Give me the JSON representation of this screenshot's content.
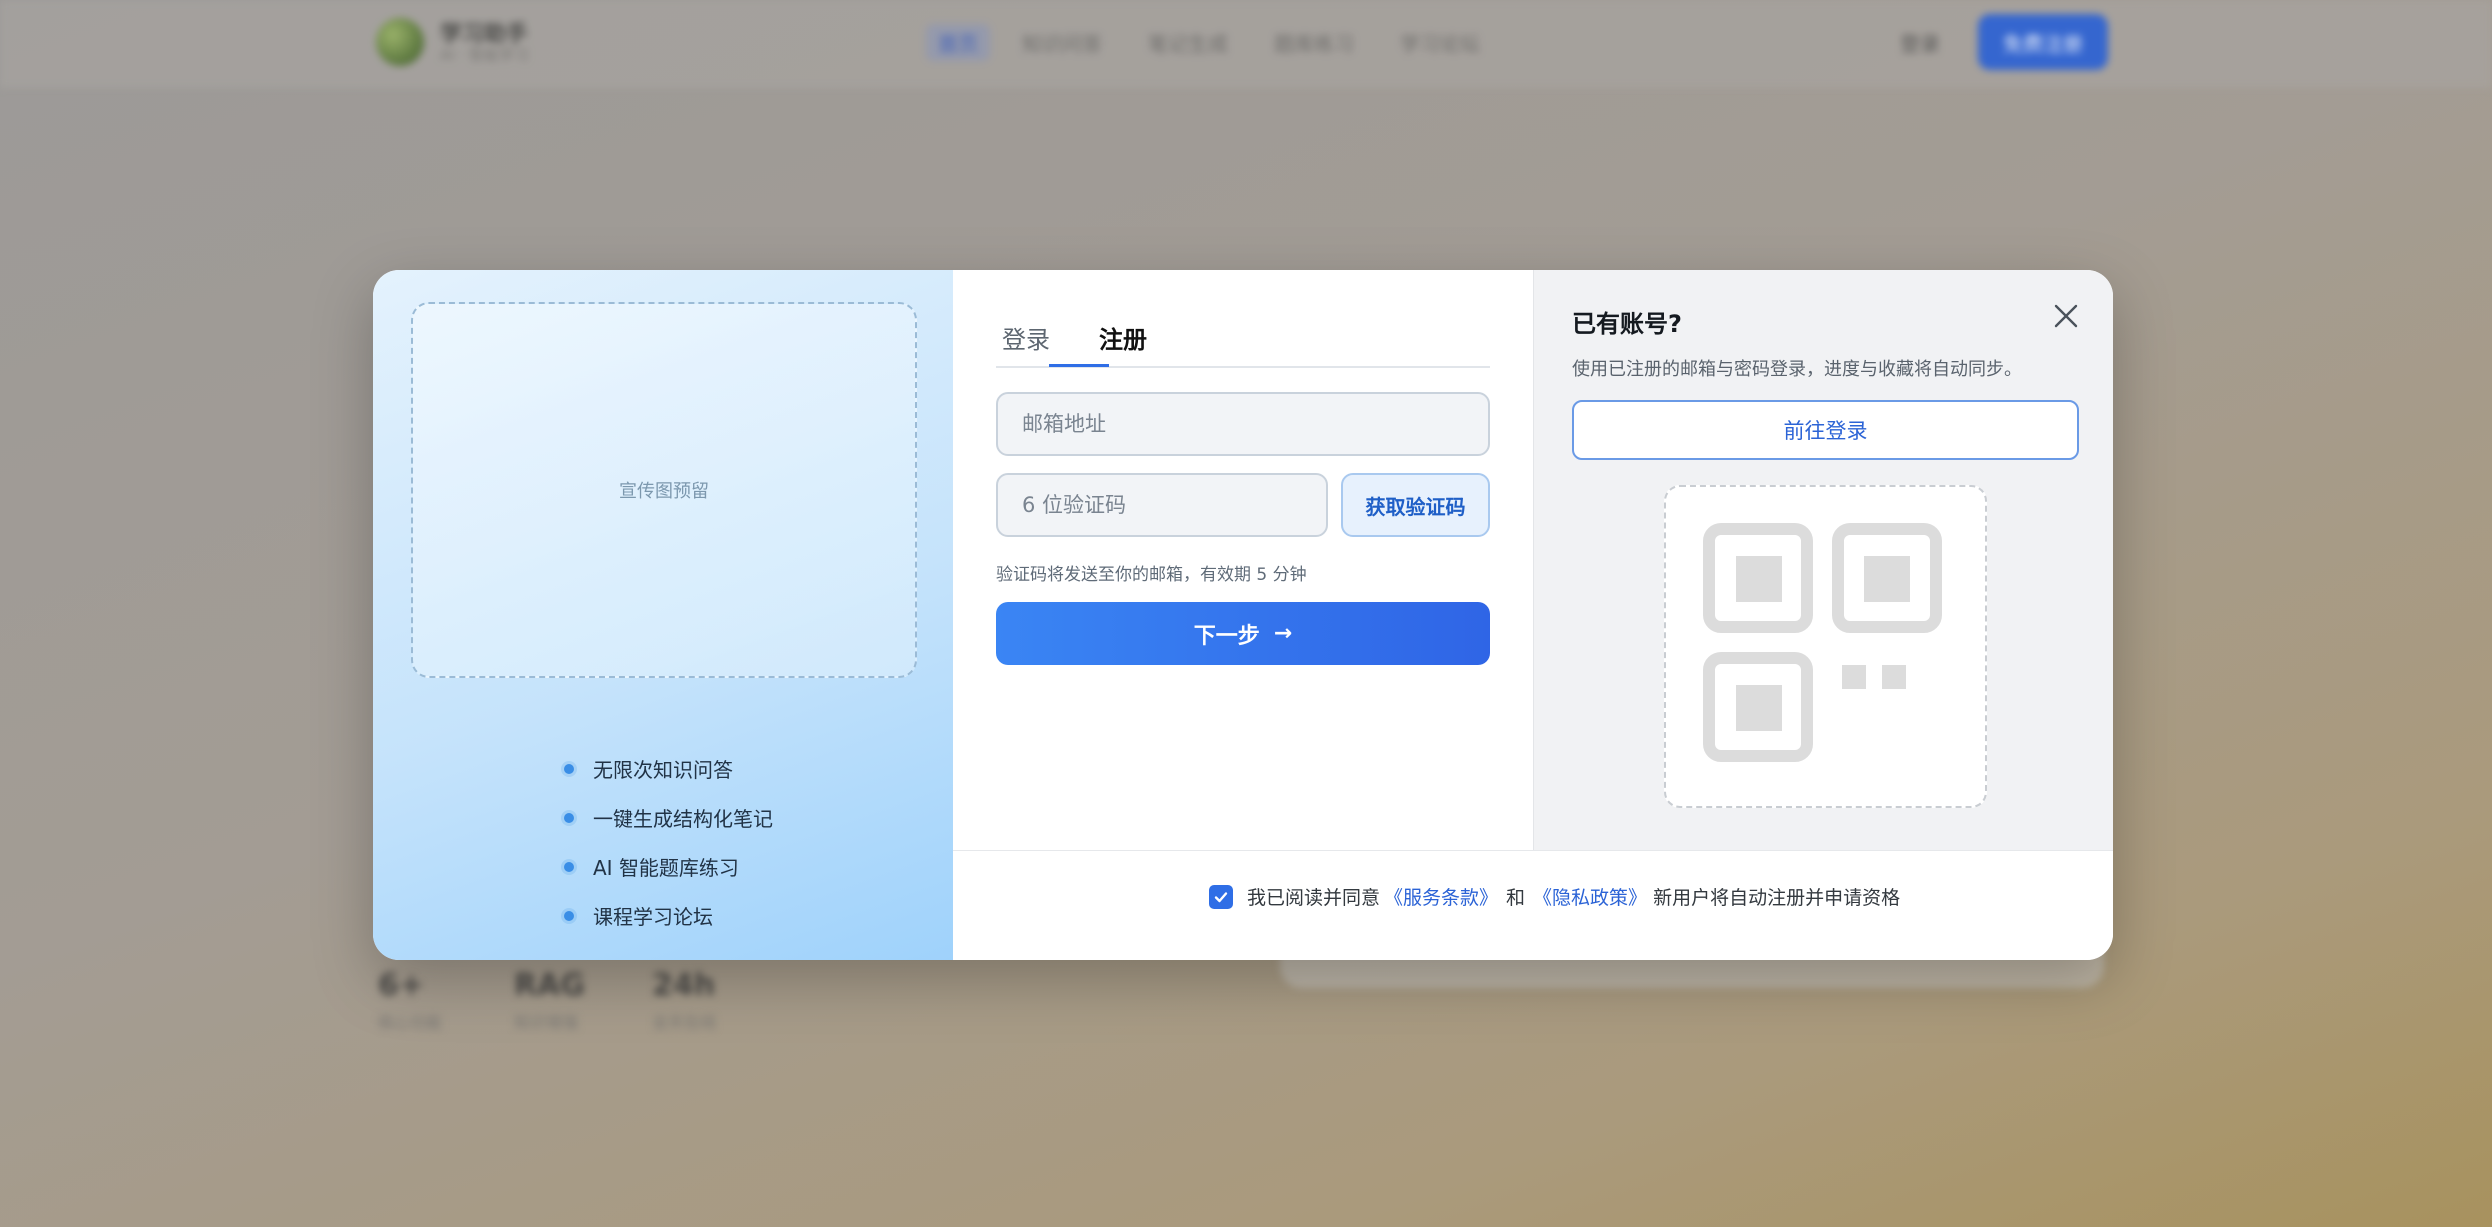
{
  "background": {
    "logo": {
      "title": "学习助手",
      "subtitle": "AI · 智能学习"
    },
    "nav": [
      "首页",
      "知识问答",
      "笔记生成",
      "题库练习",
      "学习论坛"
    ],
    "login_label": "登录",
    "signup_label": "免费注册",
    "stats": [
      {
        "value": "6+",
        "label": "核心功能"
      },
      {
        "value": "RAG",
        "label": "知识增强"
      },
      {
        "value": "24h",
        "label": "全天在线"
      }
    ]
  },
  "promo": {
    "placeholder": "宣传图预留",
    "features": [
      "无限次知识问答",
      "一键生成结构化笔记",
      "AI 智能题库练习",
      "课程学习论坛"
    ]
  },
  "auth": {
    "tabs": [
      {
        "label": "登录",
        "active": false
      },
      {
        "label": "注册",
        "active": true
      }
    ],
    "email_placeholder": "邮箱地址",
    "code_placeholder": "6 位验证码",
    "get_code_label": "获取验证码",
    "hint": "验证码将发送至你的邮箱，有效期 5 分钟",
    "next_label": "下一步",
    "next_icon": "arrow-right-icon"
  },
  "side": {
    "title": "已有账号?",
    "description": "使用已注册的邮箱与密码登录，进度与收藏将自动同步。",
    "goto_login": "前往登录",
    "close_icon": "close-icon",
    "qr_icon": "qr-code-icon"
  },
  "agreement": {
    "checked": true,
    "prefix": "我已阅读并同意",
    "terms": "《服务条款》",
    "and": "和",
    "privacy": "《隐私政策》",
    "suffix": "新用户将自动注册并申请资格"
  },
  "colors": {
    "accent": "#2f6ee6",
    "link": "#2b63d6"
  }
}
